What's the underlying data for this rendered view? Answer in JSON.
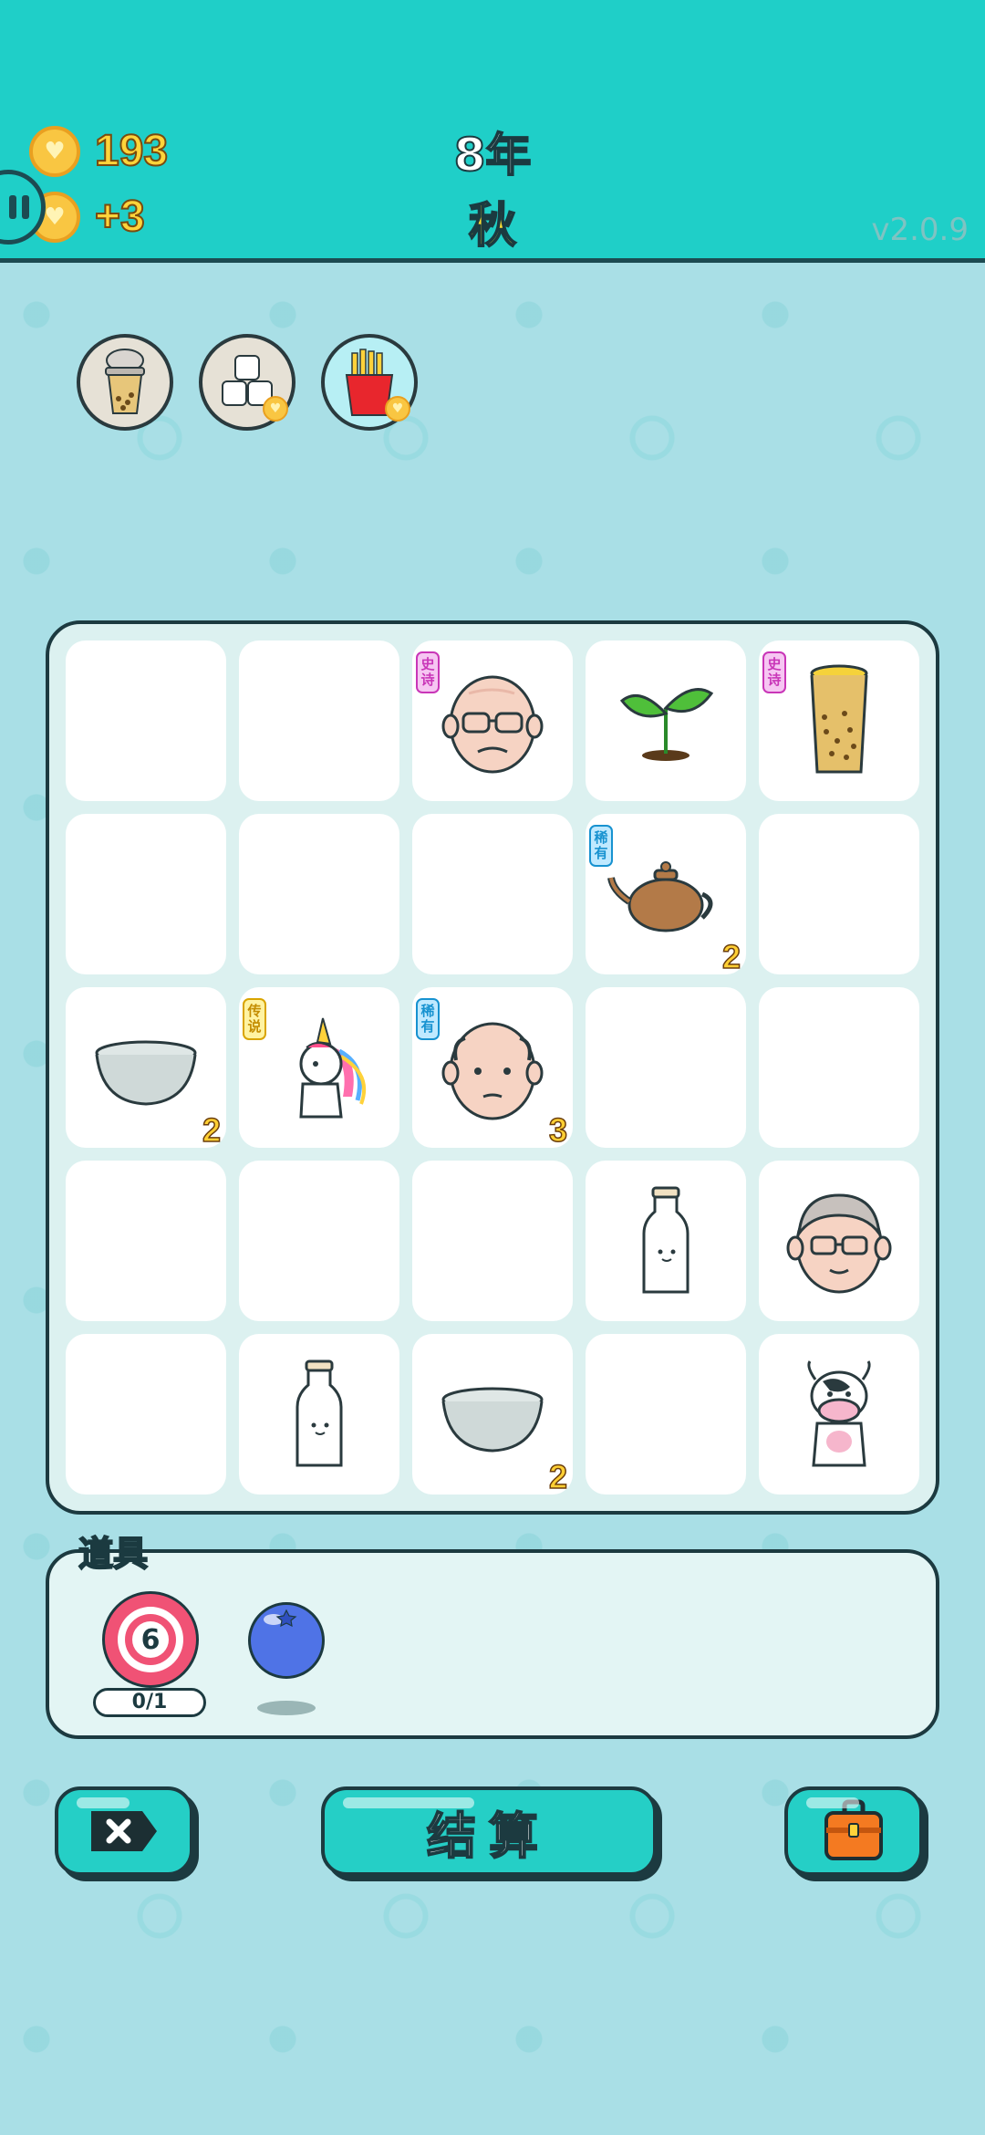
{
  "header": {
    "coins": "193",
    "income": "+3",
    "year": "8年",
    "season": "秋",
    "version": "v2.0.9"
  },
  "top_items": [
    {
      "name": "bubble-tea-cup"
    },
    {
      "name": "sugar-cubes",
      "badge": "heart-coin"
    },
    {
      "name": "french-fries",
      "badge": "heart-coin"
    }
  ],
  "board": {
    "rows": 5,
    "cols": 5,
    "cells": [
      {
        "row": 0,
        "col": 0,
        "item": ""
      },
      {
        "row": 0,
        "col": 1,
        "item": ""
      },
      {
        "row": 0,
        "col": 2,
        "item": "old-man-glasses",
        "tag": "史诗"
      },
      {
        "row": 0,
        "col": 3,
        "item": "sprout"
      },
      {
        "row": 0,
        "col": 4,
        "item": "bubble-tea-tall",
        "tag": "史诗"
      },
      {
        "row": 1,
        "col": 0,
        "item": ""
      },
      {
        "row": 1,
        "col": 1,
        "item": ""
      },
      {
        "row": 1,
        "col": 2,
        "item": ""
      },
      {
        "row": 1,
        "col": 3,
        "item": "teapot",
        "tag": "稀有",
        "count": "2"
      },
      {
        "row": 1,
        "col": 4,
        "item": ""
      },
      {
        "row": 2,
        "col": 0,
        "item": "bowl",
        "count": "2"
      },
      {
        "row": 2,
        "col": 1,
        "item": "unicorn",
        "tag": "传说"
      },
      {
        "row": 2,
        "col": 2,
        "item": "bald-man",
        "tag": "稀有",
        "count": "3"
      },
      {
        "row": 2,
        "col": 3,
        "item": ""
      },
      {
        "row": 2,
        "col": 4,
        "item": ""
      },
      {
        "row": 3,
        "col": 0,
        "item": ""
      },
      {
        "row": 3,
        "col": 1,
        "item": ""
      },
      {
        "row": 3,
        "col": 2,
        "item": ""
      },
      {
        "row": 3,
        "col": 3,
        "item": "milk-bottle"
      },
      {
        "row": 3,
        "col": 4,
        "item": "grandpa-glasses"
      },
      {
        "row": 4,
        "col": 0,
        "item": ""
      },
      {
        "row": 4,
        "col": 1,
        "item": "milk-bottle"
      },
      {
        "row": 4,
        "col": 2,
        "item": "bowl",
        "count": "2"
      },
      {
        "row": 4,
        "col": 3,
        "item": ""
      },
      {
        "row": 4,
        "col": 4,
        "item": "cow"
      }
    ]
  },
  "tools": {
    "title": "道具",
    "target_number": "6",
    "target_uses": "0/1",
    "items": [
      "target-icon",
      "blue-ball-icon"
    ]
  },
  "buttons": {
    "close_icon": "close-icon",
    "settle_label": "结算",
    "bag_icon": "briefcase-icon"
  },
  "colors": {
    "header_bg": "#1fcfc8",
    "page_bg": "#a9dfe6",
    "button_bg": "#25cfc6",
    "coin": "#f9c642",
    "outline": "#1c3a40"
  }
}
